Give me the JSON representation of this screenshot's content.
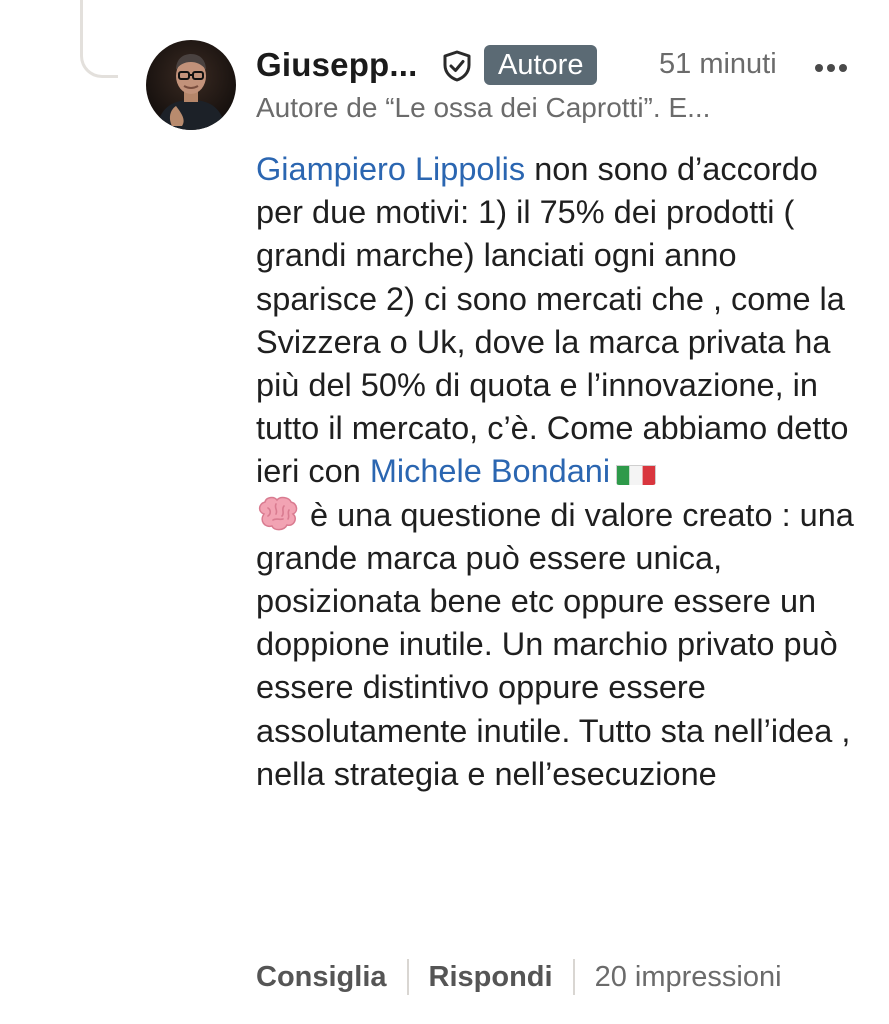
{
  "comment": {
    "author": {
      "name": "Giusepp...",
      "badge": "Autore",
      "headline": "Autore de “Le ossa dei Caprotti”. E...",
      "time": "51 minuti"
    },
    "body": {
      "mention_1": "Giampiero Lippolis",
      "text_1": " non sono d’accordo per due motivi: 1) il 75% dei prodotti ( grandi marche) lanciati ogni anno sparisce 2) ci sono mercati che , come la Svizzera o Uk, dove la marca privata ha più del 50% di quota e l’innovazione, in tutto il mercato, c’è. Come abbiamo detto ieri con ",
      "mention_2": "Michele Bondani",
      "text_2": "è una questione di valore creato : una grande marca può essere unica, posizionata bene etc oppure essere un doppione inutile. Un marchio privato può essere distintivo oppure essere assolutamente inutile. Tutto sta nell’idea , nella strategia e nell’esecuzione"
    },
    "actions": {
      "like": "Consiglia",
      "reply": "Rispondi",
      "impressions": "20 impressioni"
    }
  },
  "icons": {
    "verified": "shield-check-icon",
    "more": "more-horizontal-icon",
    "flag": "italy-flag-icon",
    "brain": "brain-icon"
  },
  "colors": {
    "mention": "#2b66b1",
    "badge_bg": "#5b6a74",
    "secondary_text": "#6b6b6b"
  }
}
